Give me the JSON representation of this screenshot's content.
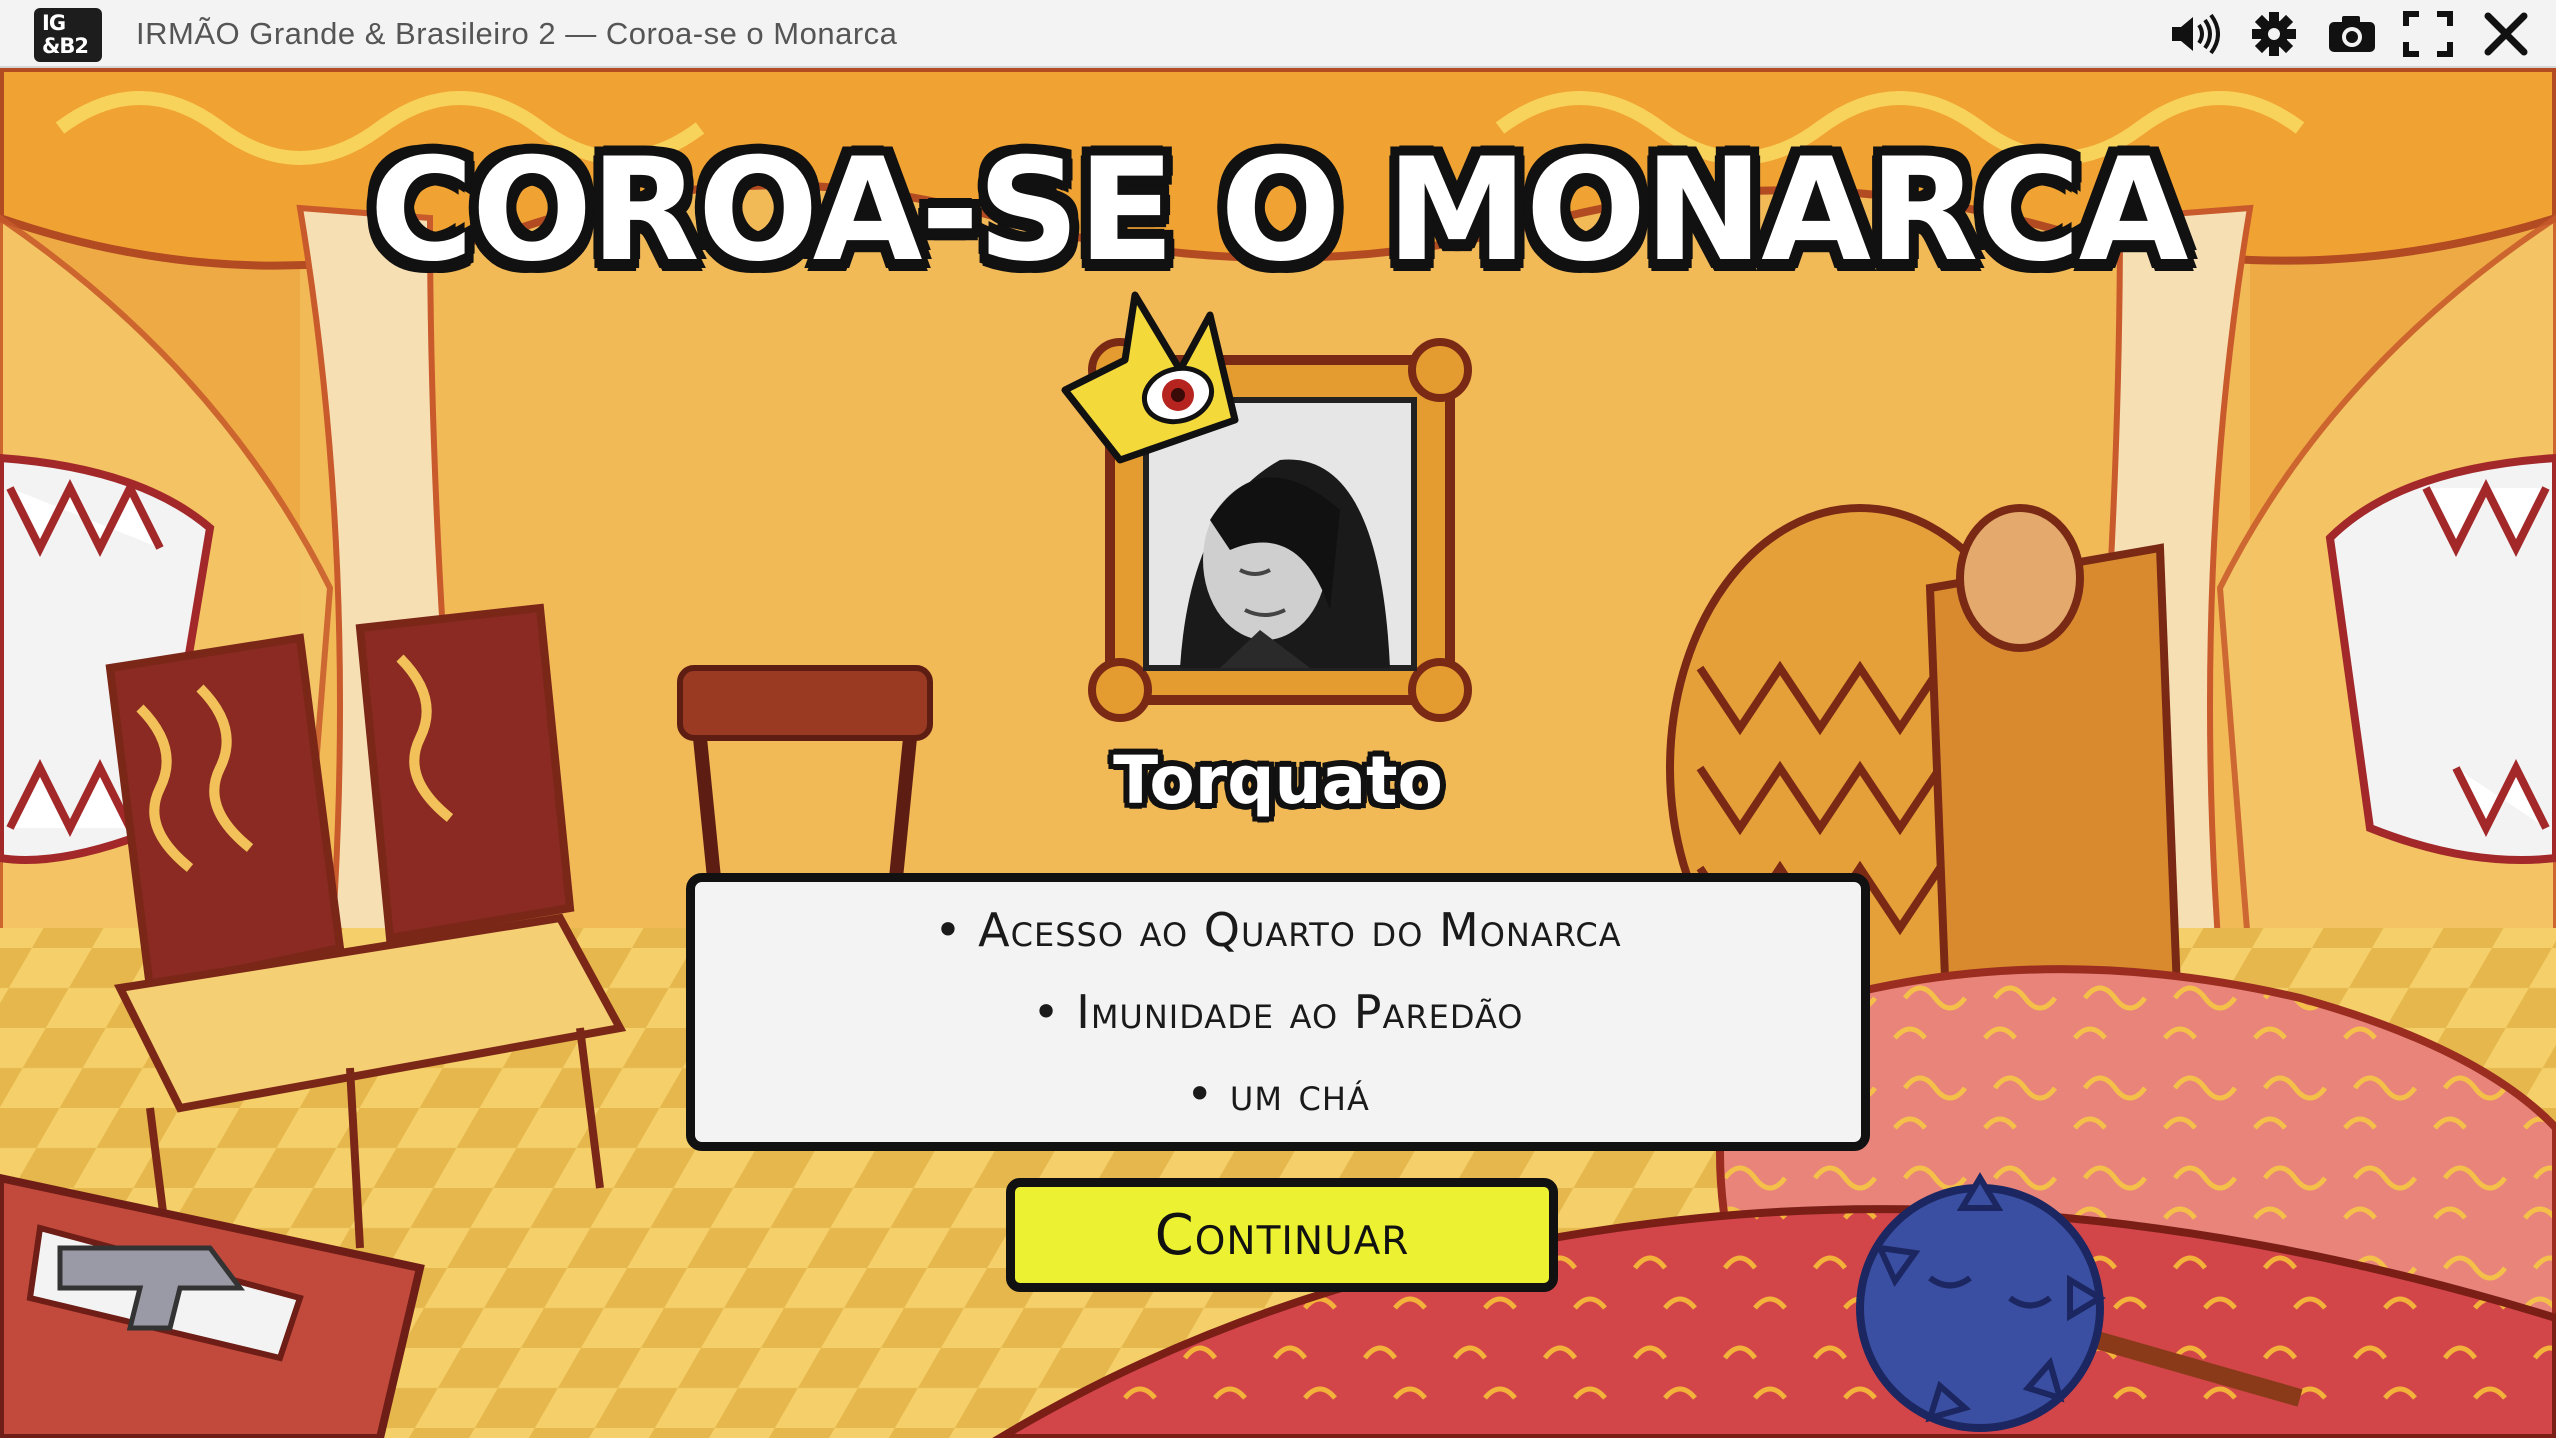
{
  "window": {
    "logo_line1": "IG",
    "logo_line2": "&B2",
    "title": "IRMÃO Grande & Brasileiro 2 — Coroa-se o Monarca",
    "icons": [
      "volume-icon",
      "gear-icon",
      "camera-icon",
      "fullscreen-icon",
      "close-icon"
    ]
  },
  "screen": {
    "headline": "COROA-SE O MONARCA",
    "winner_name": "Torquato",
    "perks": [
      "Acesso ao Quarto do Monarca",
      "Imunidade ao Paredão",
      "um chá"
    ],
    "continue_label": "Continuar"
  },
  "colors": {
    "button_yellow": "#ecf232",
    "crown_yellow": "#f4d93b",
    "scene_orange": "#e9a43a",
    "outline": "#111111"
  }
}
